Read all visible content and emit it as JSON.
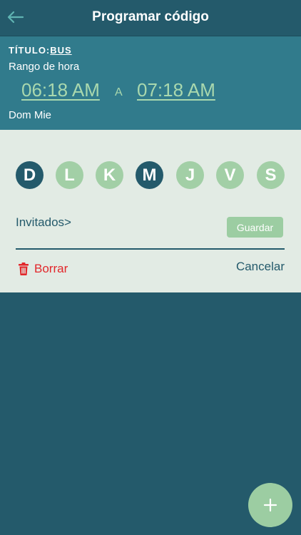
{
  "nav": {
    "title": "Programar código"
  },
  "summary": {
    "title_label": "TÍTULO:",
    "title_value": "BUS",
    "range_label": "Rango de hora",
    "start_time": "06:18 AM",
    "separator": "A",
    "end_time": "07:18 AM",
    "days_text": "Dom Mie"
  },
  "editor": {
    "days": [
      {
        "letter": "D",
        "selected": true
      },
      {
        "letter": "L",
        "selected": false
      },
      {
        "letter": "K",
        "selected": false
      },
      {
        "letter": "M",
        "selected": true
      },
      {
        "letter": "J",
        "selected": false
      },
      {
        "letter": "V",
        "selected": false
      },
      {
        "letter": "S",
        "selected": false
      }
    ],
    "guests_label": "Invitados>",
    "save_label": "Guardar",
    "delete_label": "Borrar",
    "cancel_label": "Cancelar"
  },
  "colors": {
    "primary": "#245a6b",
    "header_panel": "#317b8c",
    "accent_green": "#9ccda2",
    "panel_bg": "#e2ebe4",
    "danger": "#e2272b"
  },
  "icons": {
    "back": "arrow-left-icon",
    "delete": "trash-icon",
    "add": "plus-icon"
  }
}
